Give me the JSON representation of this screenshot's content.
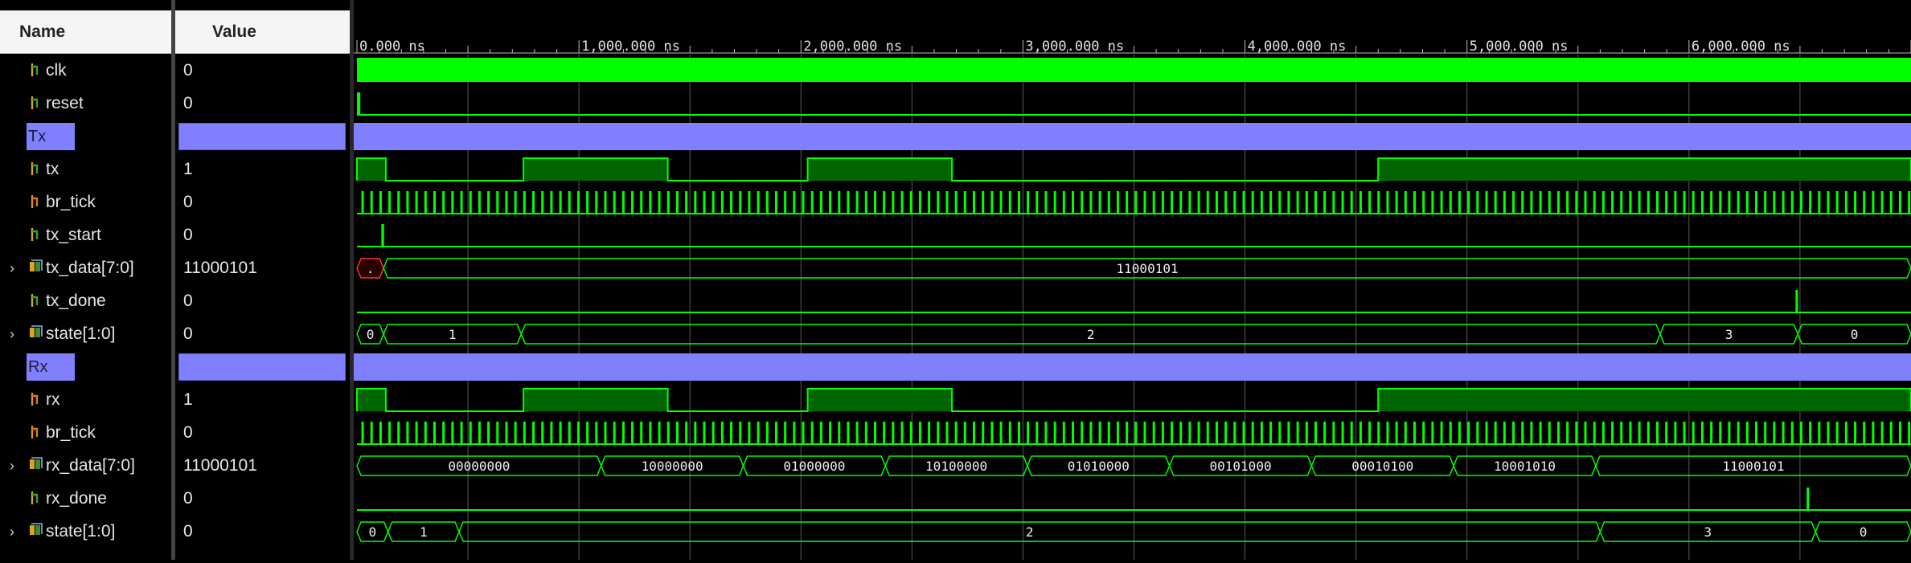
{
  "header": {
    "name_col": "Name",
    "value_col": "Value"
  },
  "signals": [
    {
      "name": "clk",
      "value": "0",
      "kind": "bit",
      "expandable": false
    },
    {
      "name": "reset",
      "value": "0",
      "kind": "bit",
      "expandable": false
    },
    {
      "name": "Tx",
      "value": "",
      "kind": "group",
      "expandable": false
    },
    {
      "name": "tx",
      "value": "1",
      "kind": "bit",
      "expandable": false
    },
    {
      "name": "br_tick",
      "value": "0",
      "kind": "bit-orange",
      "expandable": false
    },
    {
      "name": "tx_start",
      "value": "0",
      "kind": "bit",
      "expandable": false
    },
    {
      "name": "tx_data[7:0]",
      "value": "11000101",
      "kind": "bus",
      "expandable": true
    },
    {
      "name": "tx_done",
      "value": "0",
      "kind": "bit",
      "expandable": false
    },
    {
      "name": "state[1:0]",
      "value": "0",
      "kind": "bus",
      "expandable": true
    },
    {
      "name": "Rx",
      "value": "",
      "kind": "group",
      "expandable": false
    },
    {
      "name": "rx",
      "value": "1",
      "kind": "bit-orange",
      "expandable": false
    },
    {
      "name": "br_tick",
      "value": "0",
      "kind": "bit-orange",
      "expandable": false
    },
    {
      "name": "rx_data[7:0]",
      "value": "11000101",
      "kind": "bus",
      "expandable": true
    },
    {
      "name": "rx_done",
      "value": "0",
      "kind": "bit",
      "expandable": false
    },
    {
      "name": "state[1:0]",
      "value": "0",
      "kind": "bus",
      "expandable": true
    }
  ],
  "timeline": {
    "unit": "ns",
    "labels": [
      "0.000 ns",
      "1,000.000 ns",
      "2,000.000 ns",
      "3,000.000 ns",
      "4,000.000 ns",
      "5,000.000 ns",
      "6,000.000 ns"
    ],
    "label_times": [
      0,
      1000,
      2000,
      3000,
      4000,
      5000,
      6000
    ],
    "window_end_ns": 7000
  },
  "waves": {
    "clk": {
      "type": "solid_high"
    },
    "reset": {
      "type": "pulses",
      "pulses": [
        [
          0,
          15
        ]
      ]
    },
    "tx": {
      "type": "levels",
      "high": [
        [
          0,
          130
        ],
        [
          750,
          1400
        ],
        [
          2030,
          2680
        ],
        [
          4600,
          7000
        ]
      ]
    },
    "br_tick": {
      "type": "ticks",
      "period": 40.5,
      "start": 20
    },
    "tx_start": {
      "type": "pulses",
      "pulses": [
        [
          110,
          122
        ]
      ]
    },
    "tx_data": {
      "type": "bus",
      "segments": [
        {
          "from": 0,
          "to": 120,
          "label": ".",
          "invalid": true
        },
        {
          "from": 120,
          "to": 7000,
          "label": "11000101"
        }
      ]
    },
    "tx_done": {
      "type": "pulses",
      "pulses": [
        [
          6480,
          6490
        ]
      ]
    },
    "tx_state": {
      "type": "bus",
      "segments": [
        {
          "from": 0,
          "to": 120,
          "label": "0"
        },
        {
          "from": 120,
          "to": 740,
          "label": "1"
        },
        {
          "from": 740,
          "to": 5870,
          "label": "2"
        },
        {
          "from": 5870,
          "to": 6490,
          "label": "3"
        },
        {
          "from": 6490,
          "to": 7000,
          "label": "0"
        }
      ]
    },
    "rx": {
      "type": "levels",
      "high": [
        [
          0,
          130
        ],
        [
          750,
          1400
        ],
        [
          2030,
          2680
        ],
        [
          4600,
          7000
        ]
      ]
    },
    "rx_data": {
      "type": "bus",
      "segments": [
        {
          "from": 0,
          "to": 1100,
          "label": "00000000"
        },
        {
          "from": 1100,
          "to": 1740,
          "label": "10000000"
        },
        {
          "from": 1740,
          "to": 2380,
          "label": "01000000"
        },
        {
          "from": 2380,
          "to": 3020,
          "label": "10100000"
        },
        {
          "from": 3020,
          "to": 3660,
          "label": "01010000"
        },
        {
          "from": 3660,
          "to": 4300,
          "label": "00101000"
        },
        {
          "from": 4300,
          "to": 4940,
          "label": "00010100"
        },
        {
          "from": 4940,
          "to": 5580,
          "label": "10001010"
        },
        {
          "from": 5580,
          "to": 7000,
          "label": "11000101"
        }
      ]
    },
    "rx_done": {
      "type": "pulses",
      "pulses": [
        [
          6530,
          6540
        ]
      ]
    },
    "rx_state": {
      "type": "bus",
      "segments": [
        {
          "from": 0,
          "to": 140,
          "label": "0"
        },
        {
          "from": 140,
          "to": 460,
          "label": "1"
        },
        {
          "from": 460,
          "to": 5600,
          "label": "2"
        },
        {
          "from": 5600,
          "to": 6570,
          "label": "3"
        },
        {
          "from": 6570,
          "to": 7000,
          "label": "0"
        }
      ]
    }
  },
  "colors": {
    "wave": "#00ff00",
    "wave_fill": "#006400",
    "group": "#8080ff",
    "invalid": "#ff3030",
    "grid": "#5a5a5a"
  }
}
